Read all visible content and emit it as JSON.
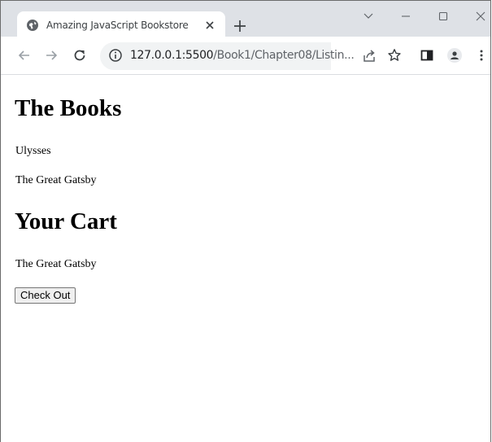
{
  "browser": {
    "tab_title": "Amazing JavaScript Bookstore",
    "url_host": "127.0.0.1:5500",
    "url_path": "/Book1/Chapter08/Listin..."
  },
  "page": {
    "books_heading": "The Books",
    "books": [
      "Ulysses",
      "The Great Gatsby"
    ],
    "cart_heading": "Your Cart",
    "cart_items": [
      "The Great Gatsby"
    ],
    "checkout_label": "Check Out"
  },
  "icons": {
    "favicon": "globe-icon",
    "tab_close": "close-icon",
    "new_tab": "plus-icon",
    "back": "arrow-left-icon",
    "forward": "arrow-right-icon",
    "reload": "reload-icon",
    "site_info": "info-icon",
    "share": "share-icon",
    "bookmark": "star-icon",
    "side_panel": "side-panel-icon",
    "profile": "profile-icon",
    "menu": "kebab-menu-icon"
  }
}
